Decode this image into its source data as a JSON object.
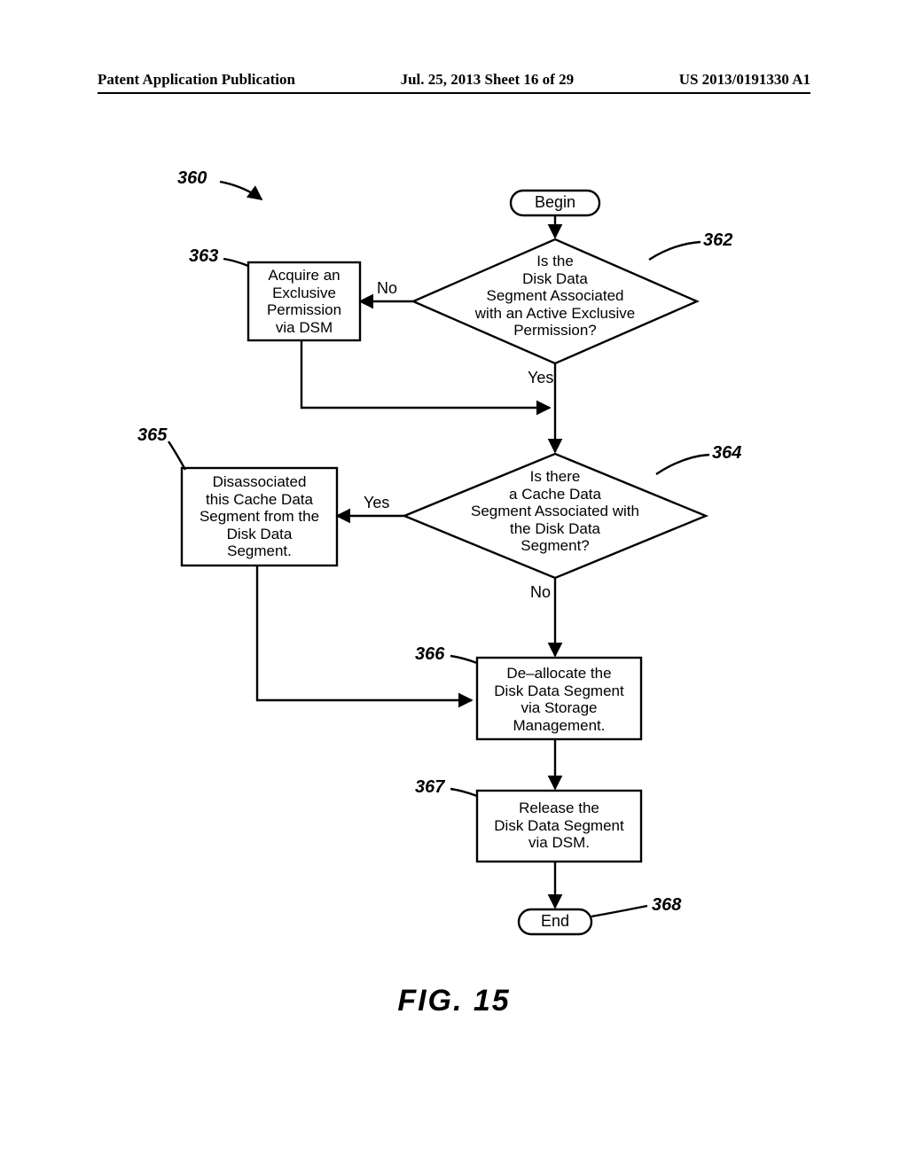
{
  "header": {
    "left": "Patent Application Publication",
    "center": "Jul. 25, 2013  Sheet 16 of 29",
    "right": "US 2013/0191330 A1"
  },
  "refs": {
    "r360": "360",
    "r362": "362",
    "r363": "363",
    "r364": "364",
    "r365": "365",
    "r366": "366",
    "r367": "367",
    "r368": "368"
  },
  "nodes": {
    "begin": "Begin",
    "d362": "Is the\nDisk Data\nSegment Associated\nwith an Active Exclusive\nPermission?",
    "p363": "Acquire an\nExclusive\nPermission\nvia DSM",
    "d364": "Is there\na Cache Data\nSegment Associated with\nthe Disk Data\nSegment?",
    "p365": "Disassociated\nthis Cache Data\nSegment from the\nDisk Data\nSegment.",
    "p366": "De–allocate the\nDisk Data Segment\nvia Storage\nManagement.",
    "p367": "Release the\nDisk Data Segment\nvia DSM.",
    "end": "End"
  },
  "branches": {
    "no1": "No",
    "yes1": "Yes",
    "yes2": "Yes",
    "no2": "No"
  },
  "figure": "FIG.  15"
}
